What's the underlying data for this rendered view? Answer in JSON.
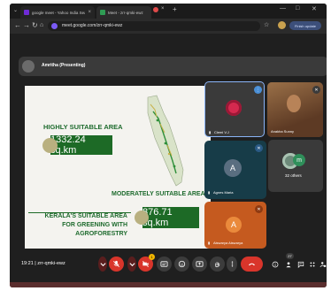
{
  "browser": {
    "tabs": [
      {
        "label": "google meet - Yahoo India Search",
        "active": false
      },
      {
        "label": "Meet - zrr-qmki-ewz",
        "active": true
      }
    ],
    "new_tab": "+",
    "window_controls": [
      "—",
      "□",
      "✕"
    ],
    "url": "meet.google.com/zrr-qmki-ewz",
    "finish_update_label": "Finish update"
  },
  "meeting": {
    "presenter_label": "Amritha (Presenting)",
    "code": "zrr-qmki-ewz",
    "time": "19:21",
    "participant_count": "27",
    "reaction_hand": "1"
  },
  "slide": {
    "heading_highly": "HIGHLY SUITABLE AREA",
    "value_highly": "1332.24 sq.km",
    "heading_moderate": "MODERATELY SUITABLE AREA",
    "value_moderate": "876.71 sq.km",
    "footer_lines": [
      "KERALA'S SUITABLE  AREA",
      "FOR GREENING WITH",
      "AGROFORESTRY"
    ]
  },
  "participants": [
    {
      "name": "Clemi V.J",
      "kind": "photo",
      "color": "#d5294f"
    },
    {
      "name": "Anakha Sunny",
      "kind": "photo",
      "color": "#8a5a3a"
    },
    {
      "name": "Agnes Maria",
      "kind": "initial",
      "initial": "A",
      "color": "#5a6e80"
    },
    {
      "name": "32 others",
      "kind": "others"
    },
    {
      "name": "Aiswarya Aiswarya",
      "kind": "initial",
      "initial": "A",
      "color": "#ea8a3c"
    }
  ],
  "colors": {
    "accent_green": "#1d6a26",
    "end_call_red": "#d9352b",
    "tile_orange": "#c55a1f",
    "tile_teal": "#173c48"
  }
}
